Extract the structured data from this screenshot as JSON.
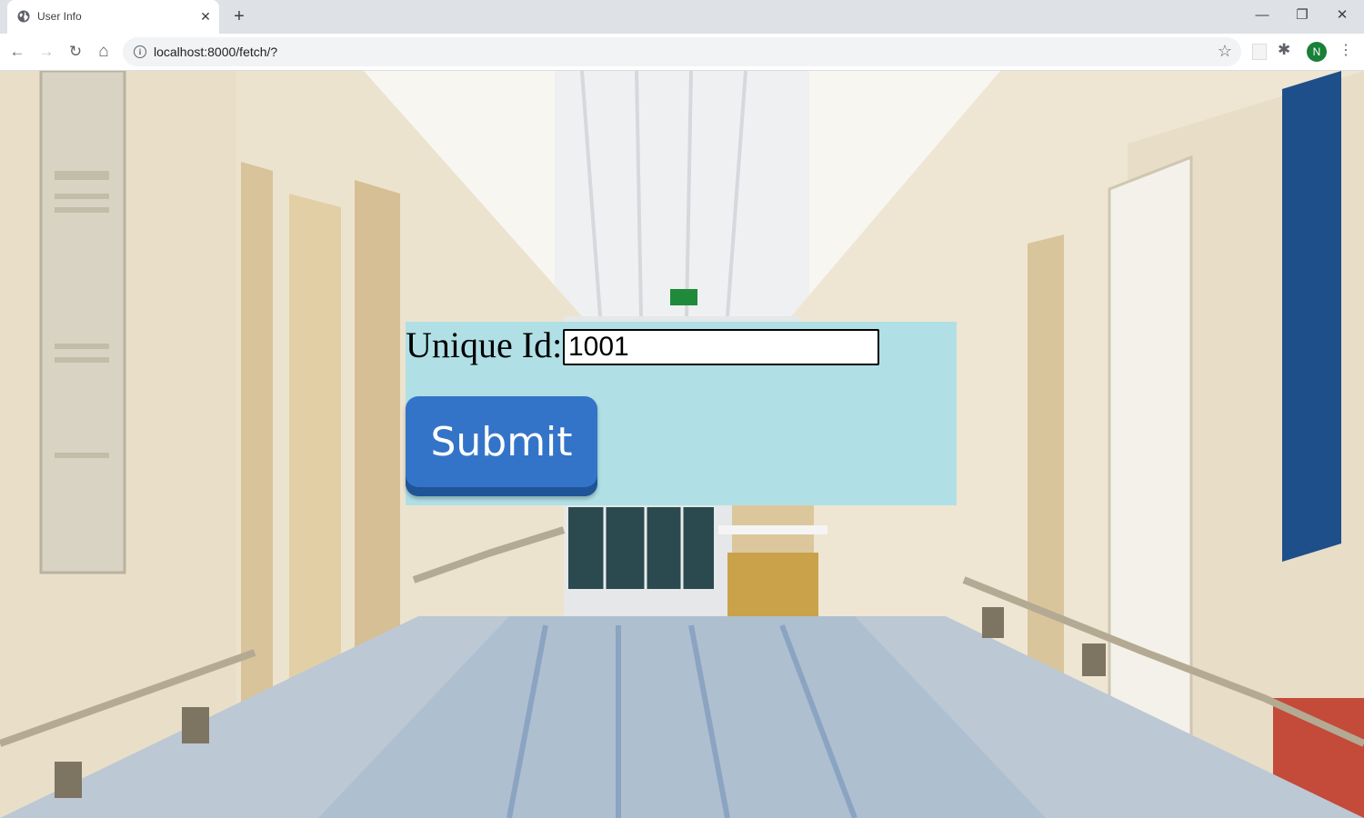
{
  "browser": {
    "tab_title": "User Info",
    "tab_close": "✕",
    "new_tab": "+",
    "url": "localhost:8000/fetch/?",
    "profile_initial": "N",
    "window_controls": {
      "minimize": "—",
      "restore": "❐",
      "close": "✕"
    },
    "icons": {
      "back": "←",
      "forward": "→",
      "reload": "↻",
      "home": "⌂",
      "info": "i",
      "star": "☆",
      "extensions": "✱",
      "menu": "⋮"
    }
  },
  "form": {
    "label": "Unique Id:",
    "input_value": "1001",
    "submit_label": "Submit"
  },
  "colors": {
    "panel_background": "#b0e0e6",
    "button": "#3474c8",
    "button_shadow": "#1f5497",
    "avatar": "#188038"
  }
}
